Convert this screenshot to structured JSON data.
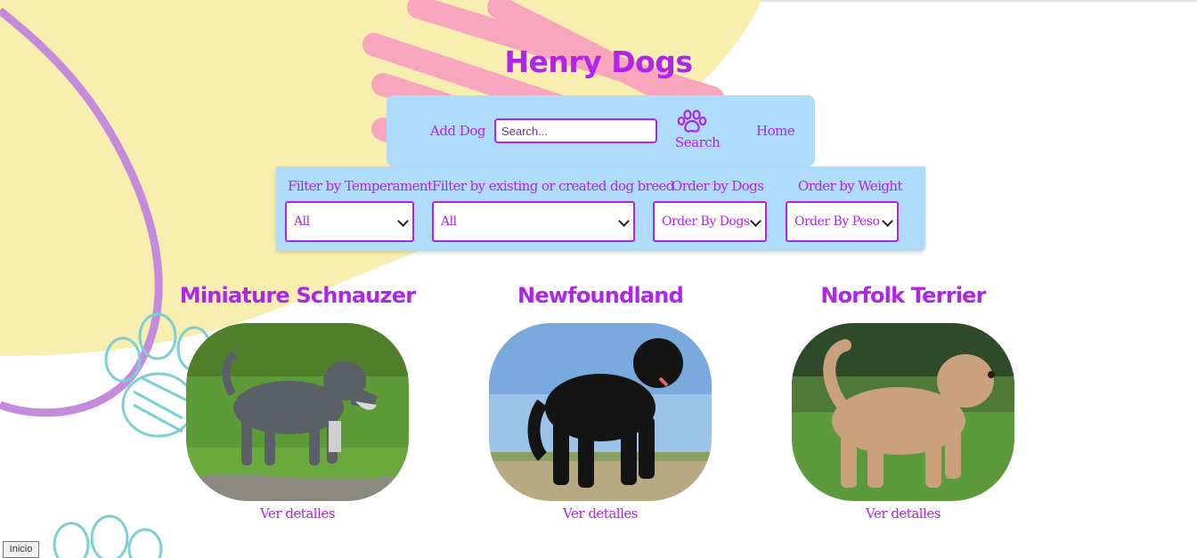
{
  "app": {
    "title": "Henry Dogs"
  },
  "nav": {
    "add_dog": "Add Dog",
    "search_placeholder": "Search...",
    "search_label": "Search",
    "home": "Home"
  },
  "filters": {
    "temperament": {
      "label": "Filter by Temperament",
      "selected": "All"
    },
    "breed_source": {
      "label": "Filter by existing or created dog breed",
      "selected": "All"
    },
    "order_dogs": {
      "label": "Order by Dogs",
      "selected": "Order By Dogs"
    },
    "order_weight": {
      "label": "Order by Weight",
      "selected": "Order By Peso"
    }
  },
  "cards": [
    {
      "name": "Miniature Schnauzer",
      "link": "Ver detalles"
    },
    {
      "name": "Newfoundland",
      "link": "Ver detalles"
    },
    {
      "name": "Norfolk Terrier",
      "link": "Ver detalles"
    }
  ],
  "footer": {
    "inicio": "Inicio"
  },
  "colors": {
    "accent": "#b025ea",
    "panel": "#aedcfa",
    "yellow_blob": "#f7eeaf",
    "pink_scribble": "#f7a6bd",
    "paw_teal": "#7dd0d1",
    "purple_stroke": "#c48adb"
  }
}
